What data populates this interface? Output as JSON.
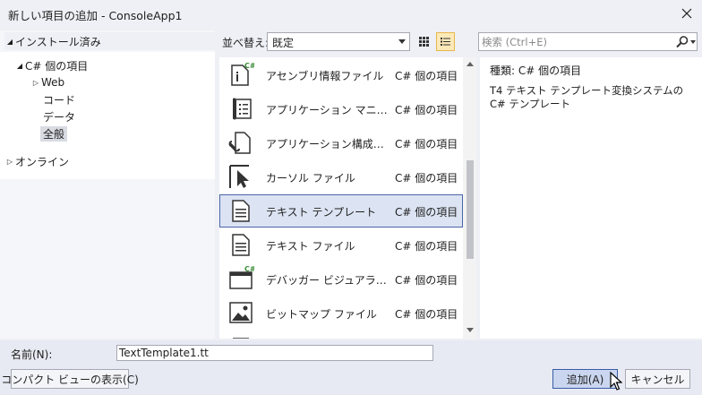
{
  "window": {
    "title": "新しい項目の追加 - ConsoleApp1"
  },
  "tree": {
    "installed": "インストール済み",
    "csharp": "C# 個の項目",
    "web": "Web",
    "code": "コード",
    "data": "データ",
    "general": "全般",
    "online": "オンライン"
  },
  "toolbar": {
    "sort_label": "並べ替え:",
    "sort_value": "既定",
    "search_placeholder": "検索 (Ctrl+E)"
  },
  "templates": [
    {
      "name": "アセンブリ情報ファイル",
      "category": "C# 個の項目",
      "icon": "assembly-info-icon"
    },
    {
      "name": "アプリケーション マニフェスト ファイル",
      "category": "C# 個の項目",
      "icon": "manifest-icon"
    },
    {
      "name": "アプリケーション構成ファイル",
      "category": "C# 個の項目",
      "icon": "config-file-icon"
    },
    {
      "name": "カーソル ファイル",
      "category": "C# 個の項目",
      "icon": "cursor-file-icon"
    },
    {
      "name": "テキスト テンプレート",
      "category": "C# 個の項目",
      "icon": "text-template-icon"
    },
    {
      "name": "テキスト ファイル",
      "category": "C# 個の項目",
      "icon": "text-file-icon"
    },
    {
      "name": "デバッガー ビジュアライザー",
      "category": "C# 個の項目",
      "icon": "debugger-visualizer-icon"
    },
    {
      "name": "ビットマップ ファイル",
      "category": "C# 個の項目",
      "icon": "bitmap-file-icon"
    }
  ],
  "details": {
    "type_label": "種類:",
    "type_value": "C# 個の項目",
    "description": "T4 テキスト テンプレート変換システムの C# テンプレート"
  },
  "bottom": {
    "name_label": "名前(N):",
    "name_value": "TextTemplate1.tt",
    "compact_view": "コンパクト ビューの表示(C)",
    "add": "追加(A)",
    "cancel": "キャンセル"
  }
}
